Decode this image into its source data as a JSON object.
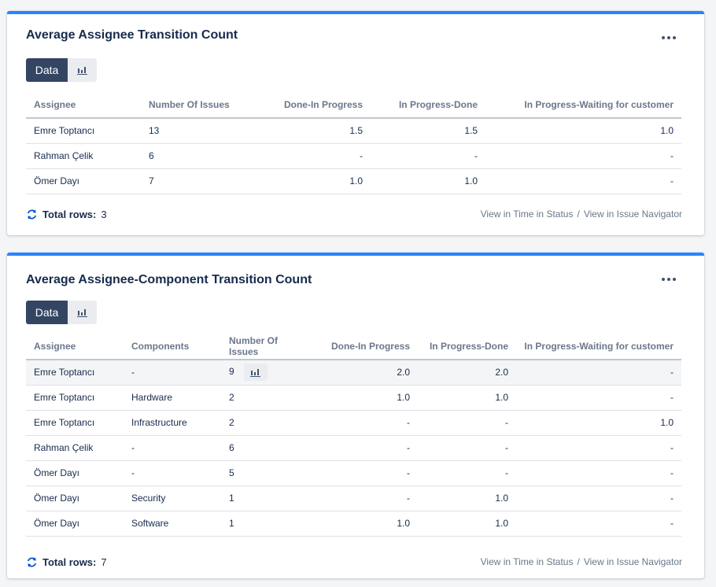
{
  "gadget1": {
    "title": "Average Assignee Transition Count",
    "toggle": {
      "data_label": "Data"
    },
    "columns": [
      "Assignee",
      "Number Of Issues",
      "Done-In Progress",
      "In Progress-Done",
      "In Progress-Waiting for customer"
    ],
    "rows": [
      [
        "Emre Toptancı",
        "13",
        "1.5",
        "1.5",
        "1.0"
      ],
      [
        "Rahman Çelik",
        "6",
        "-",
        "-",
        "-"
      ],
      [
        "Ömer Dayı",
        "7",
        "1.0",
        "1.0",
        "-"
      ]
    ],
    "footer": {
      "total_label": "Total rows:",
      "total_value": "3",
      "link_time_in_status": "View in Time in Status",
      "separator": "/",
      "link_issue_navigator": "View in Issue Navigator"
    }
  },
  "gadget2": {
    "title": "Average Assignee-Component Transition Count",
    "toggle": {
      "data_label": "Data"
    },
    "columns": [
      "Assignee",
      "Components",
      "Number Of Issues",
      "Done-In Progress",
      "In Progress-Done",
      "In Progress-Waiting for customer"
    ],
    "rows": [
      [
        "Emre Toptancı",
        "-",
        "9",
        "2.0",
        "2.0",
        "-"
      ],
      [
        "Emre Toptancı",
        "Hardware",
        "2",
        "1.0",
        "1.0",
        "-"
      ],
      [
        "Emre Toptancı",
        "Infrastructure",
        "2",
        "-",
        "-",
        "1.0"
      ],
      [
        "Rahman Çelik",
        "-",
        "6",
        "-",
        "-",
        "-"
      ],
      [
        "Ömer Dayı",
        "-",
        "5",
        "-",
        "-",
        "-"
      ],
      [
        "Ömer Dayı",
        "Security",
        "1",
        "-",
        "1.0",
        "-"
      ],
      [
        "Ömer Dayı",
        "Software",
        "1",
        "1.0",
        "1.0",
        "-"
      ]
    ],
    "footer": {
      "total_label": "Total rows:",
      "total_value": "7",
      "link_time_in_status": "View in Time in Status",
      "separator": "/",
      "link_issue_navigator": "View in Issue Navigator"
    }
  },
  "colors": {
    "accent": "#2684ff",
    "toggle_active": "#344563",
    "refresh_icon": "#0052cc"
  },
  "icons": {
    "more": "more-icon",
    "chart": "bar-chart-icon",
    "refresh": "refresh-icon"
  }
}
